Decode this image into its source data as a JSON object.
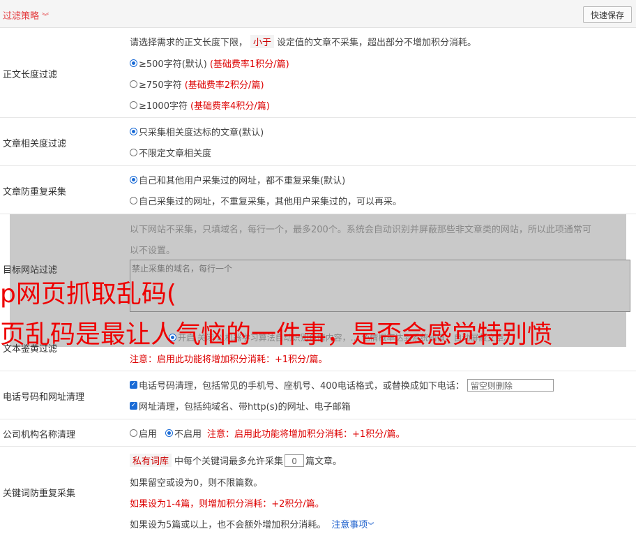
{
  "header": {
    "title": "过滤策略",
    "chevron": "chevron-down-icon",
    "save_label": "快速保存"
  },
  "length_filter": {
    "label": "正文长度过滤",
    "desc_pre": "请选择需求的正文长度下限，",
    "desc_tag": "小于",
    "desc_post": "设定值的文章不采集，超出部分不增加积分消耗。",
    "options": [
      {
        "text": "≥500字符(默认)",
        "note": "(基础费率1积分/篇)",
        "selected": true
      },
      {
        "text": "≥750字符",
        "note": "(基础费率2积分/篇)",
        "selected": false
      },
      {
        "text": "≥1000字符",
        "note": "(基础费率4积分/篇)",
        "selected": false
      }
    ]
  },
  "relevance": {
    "label": "文章相关度过滤",
    "options": [
      {
        "text": "只采集相关度达标的文章(默认)",
        "selected": true
      },
      {
        "text": "不限定文章相关度",
        "selected": false
      }
    ]
  },
  "dedupe": {
    "label": "文章防重复采集",
    "options": [
      {
        "text": "自己和其他用户采集过的网址，都不重复采集(默认)",
        "selected": true
      },
      {
        "text": "自己采集过的网址，不重复采集，其他用户采集过的，可以再采。",
        "selected": false
      }
    ]
  },
  "target_site": {
    "label": "目标网站过滤",
    "desc_line1": "以下网站不采集，只填域名，每行一个，最多200个。系统会自动识别并屏蔽那些非文章类的网站，所以此项通常可",
    "desc_line2": "以不设置。",
    "placeholder": "禁止采集的域名，每行一个"
  },
  "overlay_text": {
    "line1": "p网页抓取乱码(",
    "line2": "页乱码是最让人气恼的一件事，是否会感觉特别愤"
  },
  "porn": {
    "label": "文本鉴黄过滤",
    "line": "开启  关闭  以机器学习算法自动识别色情内容，…  色情概率达到系统阈值，自动屏蔽文章。",
    "note": "注意：启用此功能将增加积分消耗：+1积分/篇。"
  },
  "phone": {
    "label": "电话号码和网址清理",
    "opt1": "电话号码清理，包括常见的手机号、座机号、400电话格式，或替换成如下电话：",
    "opt1_placeholder": "留空则删除",
    "opt2": "网址清理，包括纯域名、带http(s)的网址、电子邮箱"
  },
  "company": {
    "label": "公司机构名称清理",
    "on": "启用",
    "off": "不启用",
    "note": "注意：启用此功能将增加积分消耗：+1积分/篇。"
  },
  "keyword": {
    "label": "关键词防重复采集",
    "tag": "私有词库",
    "pre": "中每个关键词最多允许采集",
    "value": "0",
    "post": "篇文章。",
    "line2": "如果留空或设为0，则不限篇数。",
    "line3": "如果设为1-4篇，则增加积分消耗：+2积分/篇。",
    "line4": "如果设为5篇或以上，也不会额外增加积分消耗。",
    "link": "注意事项"
  }
}
